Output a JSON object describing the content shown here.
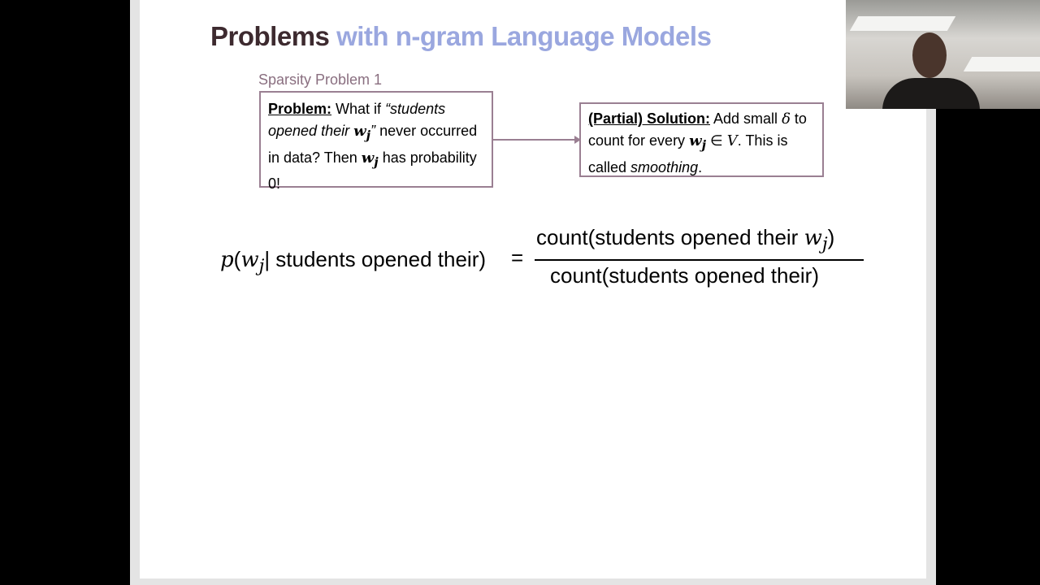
{
  "slide": {
    "title_part1": "Problems",
    "title_part2": "with n-gram Language Models",
    "caption": "Sparsity Problem 1",
    "problem": {
      "label": "Problem:",
      "text1": "What if",
      "quote_open": "“students opened their",
      "var": "w",
      "sub": "j",
      "quote_close": "”",
      "text2": "never occurred in data? Then",
      "var2": "w",
      "sub2": "j",
      "text3": "has probability 0!"
    },
    "solution": {
      "label": "(Partial) Solution:",
      "text1": "Add small",
      "delta": "δ",
      "text2": "to count for every",
      "var": "w",
      "sub": "j",
      "in": "∈",
      "vocab": "V",
      "text3": ".",
      "text4": "This is called",
      "emph": "smoothing",
      "text5": "."
    },
    "formula": {
      "lhs_p": "p",
      "lhs_var": "w",
      "lhs_sub": "j",
      "lhs_given": "| students opened their)",
      "equals": "=",
      "numerator": "count(students opened their",
      "num_var": "w",
      "num_sub": "j",
      "num_close": ")",
      "denominator": "count(students opened their)"
    }
  },
  "colors": {
    "title_dark": "#3d2a2f",
    "title_accent": "#9aa7df",
    "box_border": "#9a7f92",
    "caption": "#8a6f80"
  }
}
